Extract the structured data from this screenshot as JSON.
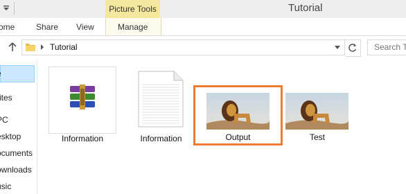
{
  "window": {
    "title": "Tutorial"
  },
  "ribbon": {
    "contextual_group": "Picture Tools",
    "tabs": [
      "ome",
      "Share",
      "View",
      "Manage"
    ]
  },
  "address": {
    "breadcrumb": "Tutorial",
    "search_placeholder": "Search T"
  },
  "nav": {
    "items": [
      "e",
      "rites",
      "PC",
      "esktop",
      "ocuments",
      "ownloads",
      "usic"
    ]
  },
  "files": [
    {
      "name": "Information",
      "icon": "winrar-archive-icon"
    },
    {
      "name": "Information",
      "icon": "text-document-icon"
    },
    {
      "name": "Output",
      "icon": "lion-image-thumbnail"
    },
    {
      "name": "Test",
      "icon": "lion-image-thumbnail"
    }
  ],
  "colors": {
    "selection_border": "#ef7d31",
    "tools_header": "#f5e79e",
    "nav_selected": "#cce8ff"
  }
}
